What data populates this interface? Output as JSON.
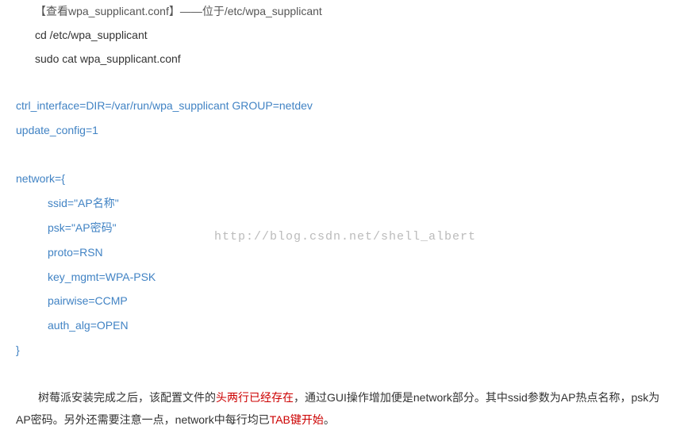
{
  "header": {
    "title": "【查看wpa_supplicant.conf】——位于/etc/wpa_supplicant"
  },
  "commands": {
    "cd": "cd /etc/wpa_supplicant",
    "cat": "sudo cat wpa_supplicant.conf"
  },
  "config": {
    "ctrl_interface": "ctrl_interface=DIR=/var/run/wpa_supplicant GROUP=netdev",
    "update_config": "update_config=1",
    "network_open": "network={",
    "ssid": "ssid=\"AP名称\"",
    "psk": "psk=\"AP密码\"",
    "proto": "proto=RSN",
    "key_mgmt": "key_mgmt=WPA-PSK",
    "pairwise": "pairwise=CCMP",
    "auth_alg": "auth_alg=OPEN",
    "network_close": "}"
  },
  "watermark": "http://blog.csdn.net/shell_albert",
  "description": {
    "part1": "树莓派安装完成之后，该配置文件的",
    "highlight1": "头两行已经存在",
    "part2": "，通过GUI操作增加便是network部分。其中ssid参数为AP热点名称，psk为AP密码。另外还需要注意一点，network中每行均已",
    "highlight2": "TAB键开始",
    "part3": "。"
  }
}
